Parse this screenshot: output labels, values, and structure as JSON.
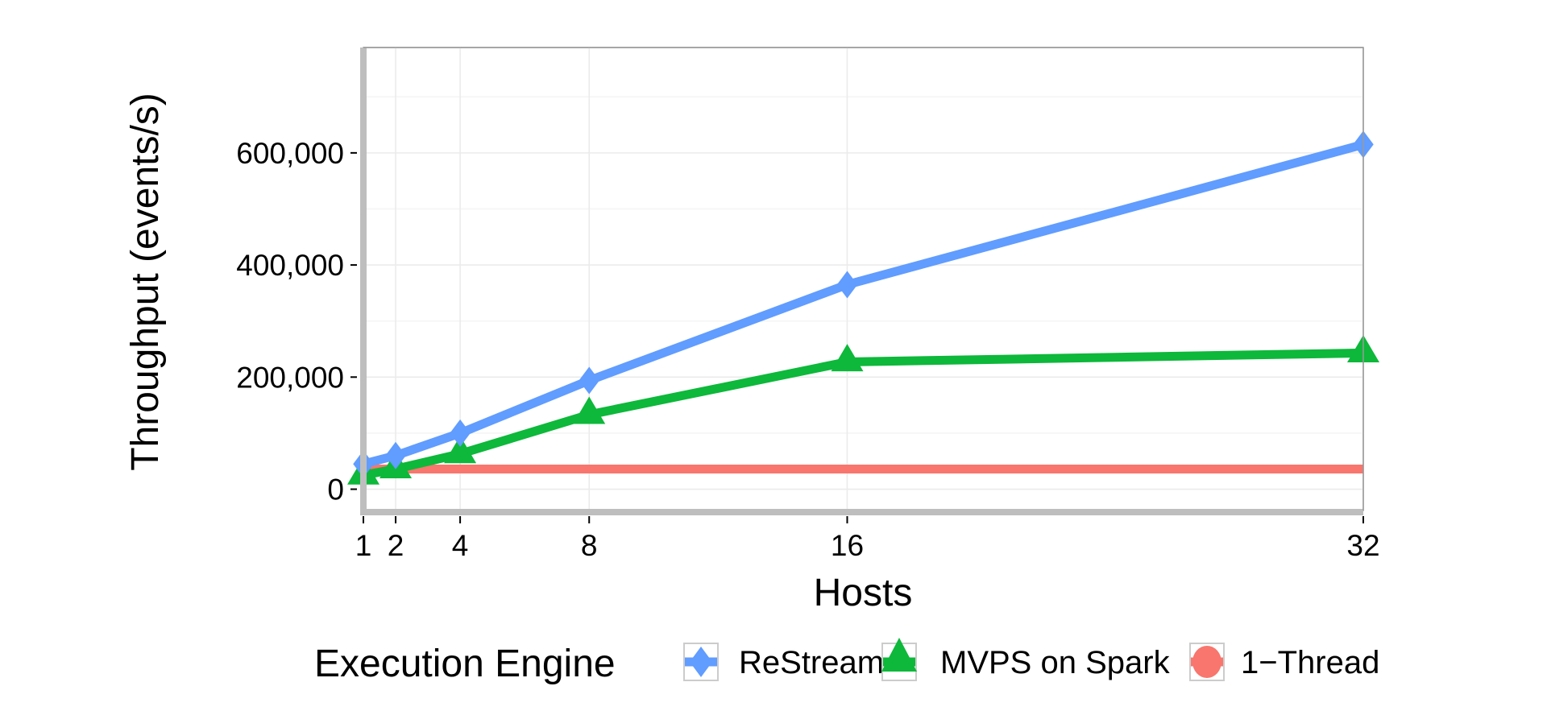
{
  "chart_data": {
    "type": "line",
    "title": "",
    "xlabel": "Hosts",
    "ylabel": "Throughput (events/s)",
    "x": [
      1,
      2,
      4,
      8,
      16,
      32
    ],
    "x_ticks": [
      1,
      2,
      4,
      8,
      16,
      32
    ],
    "x_tick_labels": [
      "1",
      "2",
      "4",
      "8",
      "16",
      "32"
    ],
    "xlim": [
      1,
      32
    ],
    "y_ticks": [
      0,
      200000,
      400000,
      600000
    ],
    "y_tick_labels": [
      "0",
      "200,000",
      "400,000",
      "600,000"
    ],
    "ylim": [
      -38000,
      788000
    ],
    "grid": true,
    "legend": {
      "title": "Execution Engine",
      "position": "bottom"
    },
    "series": [
      {
        "name": "ReStream",
        "color": "#619CFF",
        "marker": "diamond",
        "values": [
          45000,
          60000,
          100000,
          194000,
          365000,
          615000
        ]
      },
      {
        "name": "MVPS on Spark",
        "color": "#0DB83A",
        "marker": "triangle",
        "values": [
          25000,
          36000,
          63000,
          133000,
          227000,
          243000
        ]
      },
      {
        "name": "1−Thread",
        "color": "#F8766D",
        "marker": "circle",
        "values": [
          36000,
          36000,
          36000,
          36000,
          36000,
          36000
        ]
      }
    ]
  }
}
